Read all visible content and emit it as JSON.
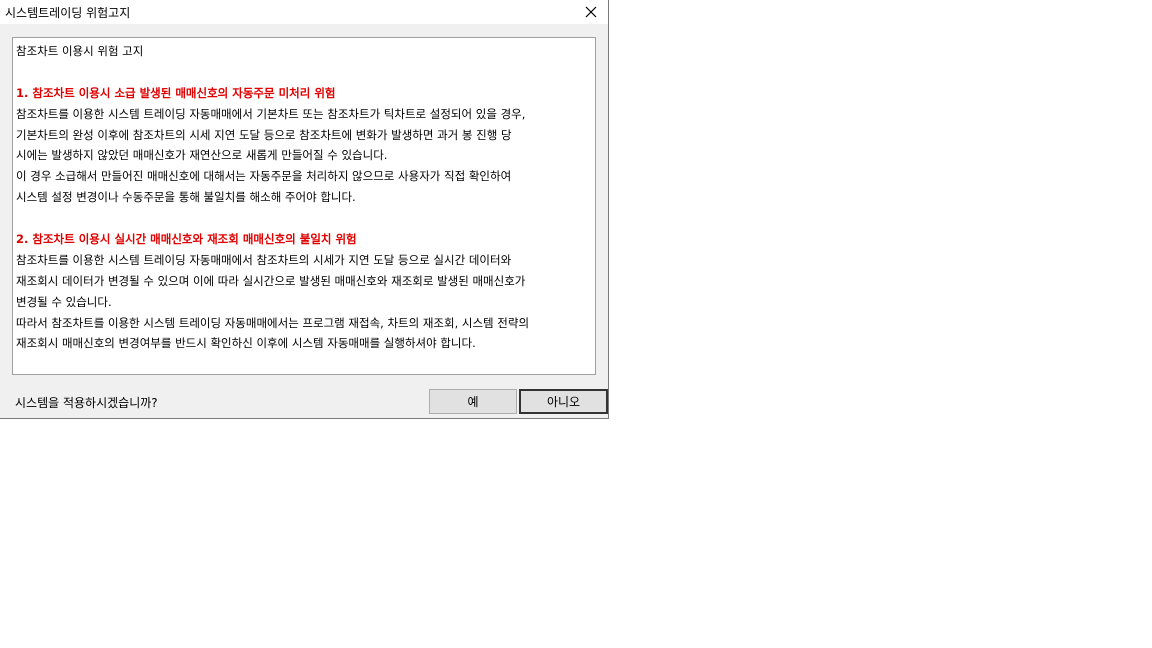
{
  "window": {
    "title": "시스템트레이딩 위험고지",
    "close_icon": "close-icon"
  },
  "notice": {
    "heading": "참조차트 이용시 위험 고지",
    "section1": {
      "title": "1. 참조차트 이용시 소급 발생된 매매신호의 자동주문 미처리 위험",
      "lines": [
        "참조차트를 이용한 시스템 트레이딩 자동매매에서 기본차트 또는 참조차트가 틱차트로 설정되어 있을 경우,",
        "기본차트의 완성 이후에 참조차트의 시세 지연 도달 등으로 참조차트에 변화가 발생하면 과거 봉 진행 당",
        "시에는 발생하지 않았던 매매신호가 재연산으로 새롭게 만들어질 수 있습니다.",
        "이 경우 소급해서 만들어진 매매신호에 대해서는 자동주문을 처리하지 않으므로 사용자가 직접 확인하여",
        "시스템 설정 변경이나 수동주문을 통해 불일치를 해소해 주어야 합니다."
      ]
    },
    "section2": {
      "title": "2. 참조차트 이용시 실시간 매매신호와 재조회 매매신호의 불일치 위험",
      "lines": [
        "참조차트를 이용한 시스템 트레이딩 자동매매에서 참조차트의 시세가 지연 도달 등으로 실시간 데이터와",
        "재조회시 데이터가 변경될 수 있으며 이에 따라 실시간으로 발생된 매매신호와 재조회로 발생된 매매신호가",
        "변경될 수 있습니다.",
        "따라서 참조차트를 이용한 시스템 트레이딩 자동매매에서는 프로그램 재접속, 차트의 재조회, 시스템 전략의",
        "재조회시 매매신호의 변경여부를 반드시 확인하신 이후에 시스템 자동매매를 실행하셔야 합니다."
      ]
    }
  },
  "footer": {
    "question": "시스템을 적용하시겠습니까?",
    "yes_label": "예",
    "no_label": "아니오"
  }
}
